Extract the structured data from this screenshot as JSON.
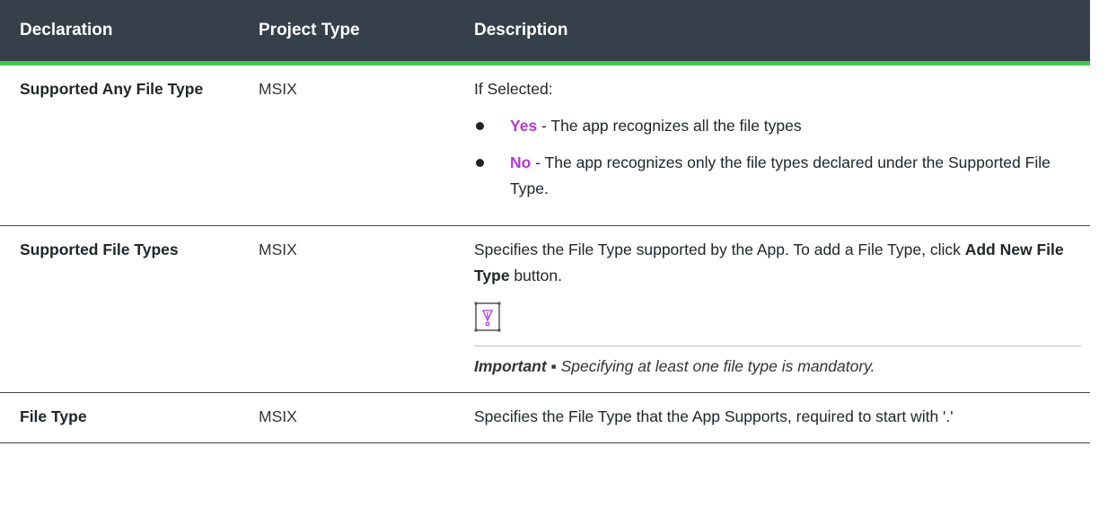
{
  "table": {
    "headers": [
      "Declaration",
      "Project Type",
      "Description"
    ],
    "rows": [
      {
        "declaration": "Supported Any File Type",
        "project_type": "MSIX",
        "intro": "If Selected:",
        "options": [
          {
            "keyword": "Yes",
            "text": " - The app recognizes all the file types"
          },
          {
            "keyword": "No",
            "text": " - The app recognizes only the file types declared under the Supported File Type."
          }
        ]
      },
      {
        "declaration": "Supported File Types",
        "project_type": "MSIX",
        "desc_part1": "Specifies the File Type supported by the App. To add a File Type, click ",
        "desc_bold": "Add New File Type",
        "desc_part2": " button.",
        "note_icon": "important-note-icon",
        "important_label": "Important ▪",
        "important_text": " Specifying at least one file type is mandatory."
      },
      {
        "declaration": "File Type",
        "project_type": "MSIX",
        "description": "Specifies the File Type that the App Supports, required to start with '.'"
      }
    ]
  },
  "colors": {
    "header_bg": "#36404a",
    "header_accent": "#3fcc4e",
    "keyword": "#b535e0"
  }
}
